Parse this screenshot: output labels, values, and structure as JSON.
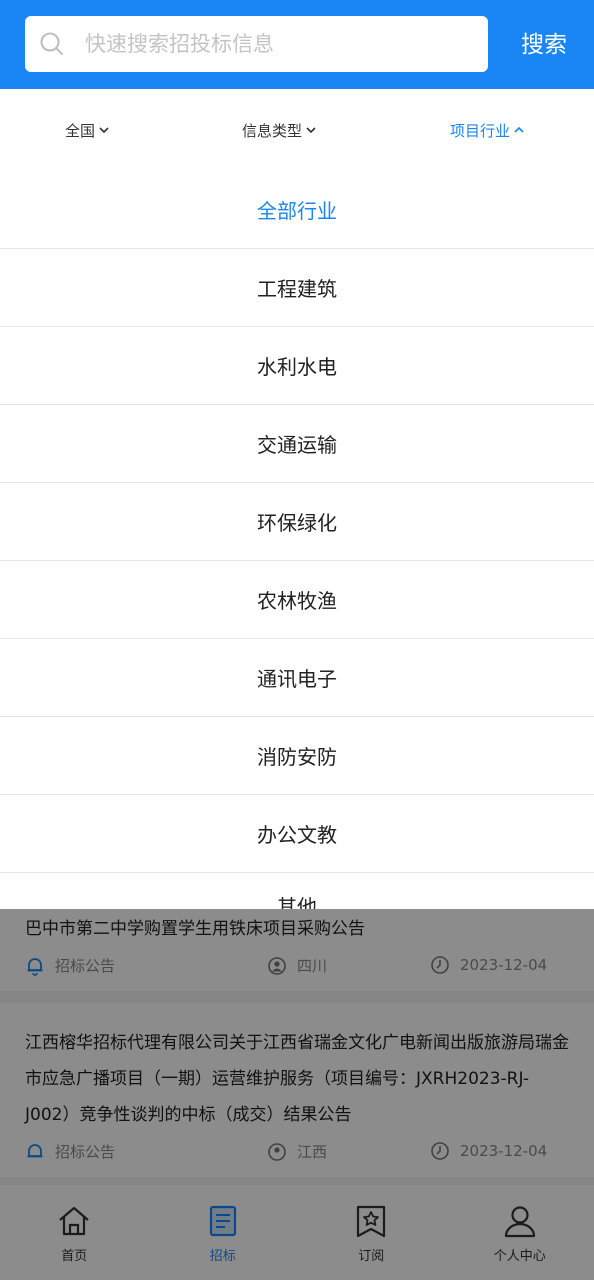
{
  "search": {
    "placeholder": "快速搜索招投标信息",
    "button_label": "搜索"
  },
  "filters": [
    {
      "label": "全国",
      "active": false
    },
    {
      "label": "信息类型",
      "active": false
    },
    {
      "label": "项目行业",
      "active": true
    }
  ],
  "dropdown": {
    "items": [
      "全部行业",
      "工程建筑",
      "水利水电",
      "交通运输",
      "环保绿化",
      "农林牧渔",
      "通讯电子",
      "消防安防",
      "办公文教",
      "其他"
    ],
    "selected_index": 0
  },
  "list": [
    {
      "title": "巴中市第二中学购置学生用铁床项目采购公告",
      "type": "招标公告",
      "region": "四川",
      "date": "2023-12-04"
    },
    {
      "title": "江西榕华招标代理有限公司关于江西省瑞金文化广电新闻出版旅游局瑞金市应急广播项目（一期）运营维护服务（项目编号：JXRH2023-RJ-J002）竞争性谈判的中标（成交）结果公告",
      "type": "招标公告",
      "region": "江西",
      "date": "2023-12-04"
    }
  ],
  "bottom_nav": [
    {
      "label": "首页",
      "icon": "home-icon"
    },
    {
      "label": "招标",
      "icon": "bid-document-icon"
    },
    {
      "label": "订阅",
      "icon": "subscribe-bookmark-icon"
    },
    {
      "label": "个人中心",
      "icon": "user-icon"
    }
  ],
  "colors": {
    "primary": "#1a86f5",
    "text": "#222222",
    "muted": "#888888"
  }
}
